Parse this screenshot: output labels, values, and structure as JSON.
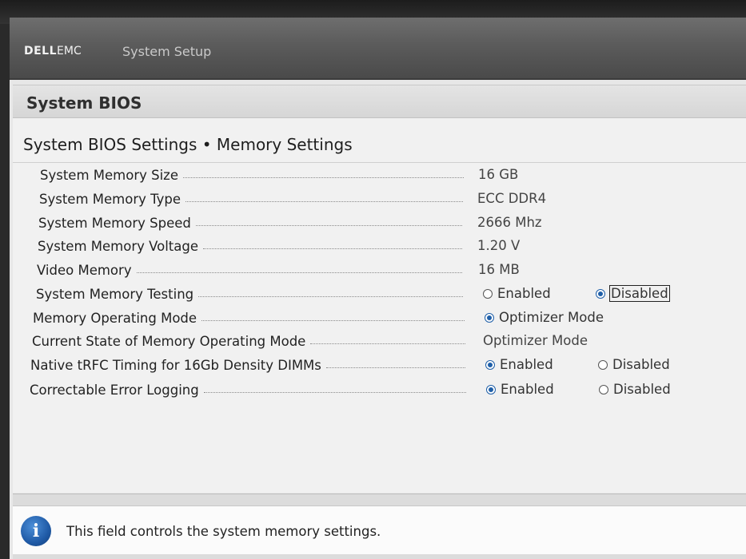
{
  "header": {
    "brand_main": "DELL",
    "brand_sub": "EMC",
    "title": "System Setup"
  },
  "page": {
    "title": "System BIOS",
    "section_title": "System BIOS Settings • Memory Settings"
  },
  "settings": [
    {
      "label": "System Memory Size",
      "value": "16 GB"
    },
    {
      "label": "System Memory Type",
      "value": "ECC DDR4"
    },
    {
      "label": "System Memory Speed",
      "value": "2666 Mhz"
    },
    {
      "label": "System Memory Voltage",
      "value": "1.20 V"
    },
    {
      "label": "Video Memory",
      "value": "16 MB"
    },
    {
      "label": "System Memory Testing",
      "options": [
        "Enabled",
        "Disabled"
      ],
      "selected": "Disabled"
    },
    {
      "label": "Memory Operating Mode",
      "options": [
        "Optimizer Mode"
      ],
      "selected": "Optimizer Mode"
    },
    {
      "label": "Current State of Memory Operating Mode",
      "value": "Optimizer Mode"
    },
    {
      "label": "Native tRFC Timing for 16Gb Density DIMMs",
      "options": [
        "Enabled",
        "Disabled"
      ],
      "selected": "Enabled"
    },
    {
      "label": "Correctable Error Logging",
      "options": [
        "Enabled",
        "Disabled"
      ],
      "selected": "Enabled"
    }
  ],
  "help": {
    "text": "This field controls the system memory settings."
  },
  "colors": {
    "radio_selected": "#1f5fa8",
    "info_icon": "#1f5aa6",
    "topbar": "#5b5b5b"
  }
}
